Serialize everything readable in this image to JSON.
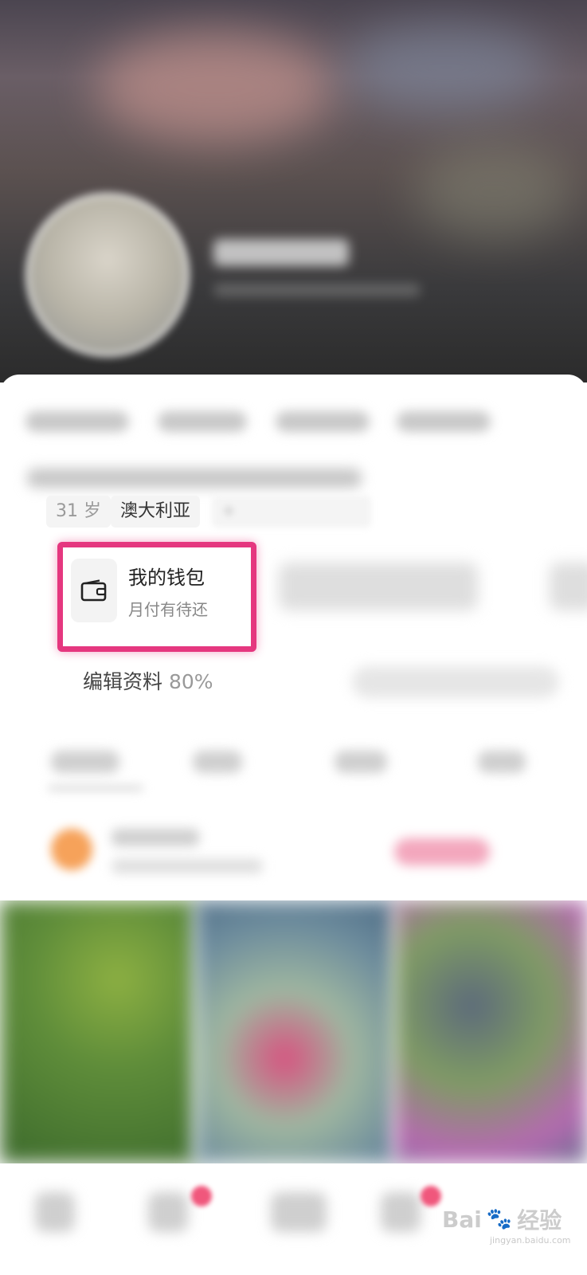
{
  "profile": {
    "tags": {
      "age": "31 岁",
      "location": "澳大利亚",
      "add": "+"
    }
  },
  "wallet": {
    "title": "我的钱包",
    "subtitle": "月付有待还",
    "icon": "wallet-icon",
    "highlight_color": "#e5377f"
  },
  "edit_profile": {
    "label": "编辑资料",
    "percent": "80%"
  },
  "watermark": {
    "brand": "Bai",
    "brand_suffix": "经验",
    "site": "jingyan.baidu.com"
  }
}
